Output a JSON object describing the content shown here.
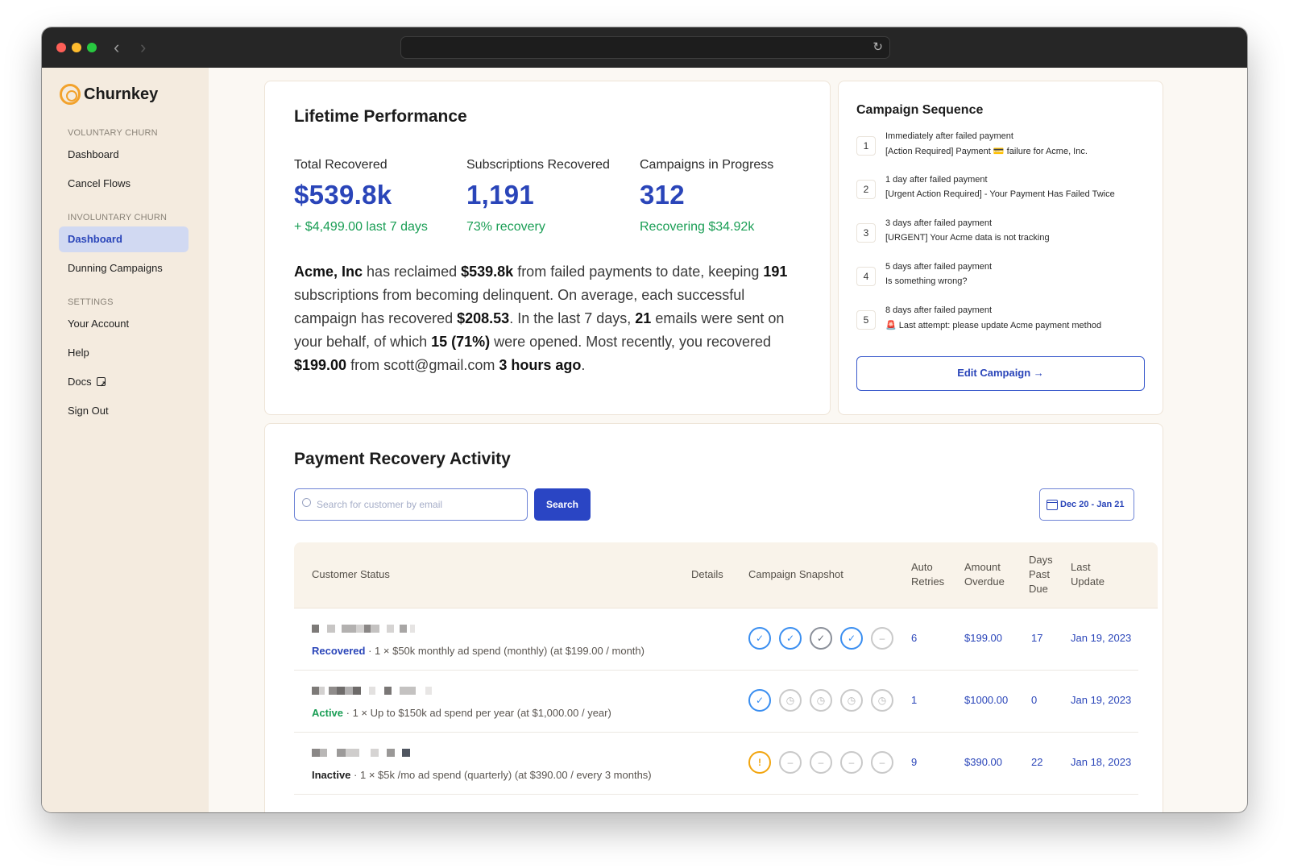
{
  "app": {
    "name": "Churnkey"
  },
  "sidebar": {
    "sections": [
      {
        "label": "VOLUNTARY CHURN",
        "items": [
          "Dashboard",
          "Cancel Flows"
        ]
      },
      {
        "label": "INVOLUNTARY CHURN",
        "items": [
          "Dashboard",
          "Dunning Campaigns"
        ]
      },
      {
        "label": "SETTINGS",
        "items": [
          "Your Account",
          "Help",
          "Docs",
          "Sign Out"
        ]
      }
    ]
  },
  "lifetime": {
    "title": "Lifetime Performance",
    "metrics": [
      {
        "label": "Total Recovered",
        "value": "$539.8k",
        "sub": "+ $4,499.00 last 7 days"
      },
      {
        "label": "Subscriptions Recovered",
        "value": "1,191",
        "sub": "73% recovery"
      },
      {
        "label": "Campaigns in Progress",
        "value": "312",
        "sub": "Recovering $34.92k"
      }
    ],
    "summary": {
      "company": "Acme, Inc",
      "t1": " has reclaimed ",
      "amount": "$539.8k",
      "t2": " from failed payments to date, keeping ",
      "subs": "191",
      "t3": " subscriptions from becoming delinquent. On average, each successful campaign has recovered ",
      "avg": "$208.53",
      "t4": ". In the last 7 days, ",
      "emails": "21",
      "t5": " emails were sent on your behalf, of which ",
      "opened": "15 (71%)",
      "t6": " were opened. Most recently, you recovered ",
      "recent": "$199.00",
      "t7": " from scott@gmail.com ",
      "ago": "3 hours ago",
      "t8": "."
    }
  },
  "campaign": {
    "title": "Campaign Sequence",
    "steps": [
      {
        "num": "1",
        "when": "Immediately after failed payment",
        "subject": "[Action Required] Payment 💳 failure for Acme, Inc."
      },
      {
        "num": "2",
        "when": "1 day after failed payment",
        "subject": "[Urgent Action Required] - Your Payment Has Failed Twice"
      },
      {
        "num": "3",
        "when": "3 days after failed payment",
        "subject": "[URGENT] Your Acme data is not tracking"
      },
      {
        "num": "4",
        "when": "5 days after failed payment",
        "subject": "Is something wrong?"
      },
      {
        "num": "5",
        "when": "8 days after failed payment",
        "subject": "🚨 Last attempt: please update Acme payment method"
      }
    ],
    "edit_label": "Edit Campaign →"
  },
  "activity": {
    "title": "Payment Recovery Activity",
    "search_placeholder": "Search for customer by email",
    "search_label": "Search",
    "date_range": "Dec 20 - Jan 21",
    "columns": {
      "status": "Customer Status",
      "details": "Details",
      "snapshot": "Campaign Snapshot",
      "retries": "Auto\nRetries",
      "amount": "Amount\nOverdue",
      "days": "Days\nPast\nDue",
      "update": "Last\nUpdate"
    },
    "rows": [
      {
        "status": "Recovered",
        "status_color": "#2a45b9",
        "plan": " · 1 × $50k monthly ad spend (monthly) (at $199.00 / month)",
        "snapshot": [
          "check",
          "check",
          "check-grey",
          "check",
          "dash"
        ],
        "retries": "6",
        "amount": "$199.00",
        "days": "17",
        "updated": "Jan 19, 2023"
      },
      {
        "status": "Active",
        "status_color": "#1a9e55",
        "plan": " · 1 × Up to $150k ad spend per year (at $1,000.00 / year)",
        "snapshot": [
          "check",
          "clock",
          "clock",
          "clock",
          "clock"
        ],
        "retries": "1",
        "amount": "$1000.00",
        "days": "0",
        "updated": "Jan 19, 2023"
      },
      {
        "status": "Inactive",
        "status_color": "#1f1f1f",
        "plan": " · 1 × $5k /mo ad spend (quarterly) (at $390.00 / every 3 months)",
        "snapshot": [
          "warn",
          "dash",
          "dash",
          "dash",
          "dash"
        ],
        "retries": "9",
        "amount": "$390.00",
        "days": "22",
        "updated": "Jan 18, 2023"
      }
    ]
  }
}
